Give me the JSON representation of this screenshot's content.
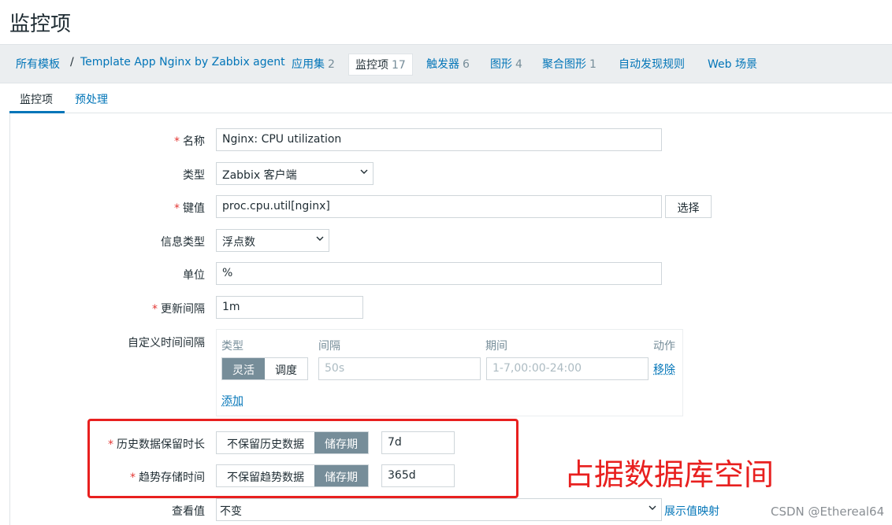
{
  "page": {
    "title": "监控项"
  },
  "breadcrumb": {
    "all_templates": "所有模板",
    "separator": "/",
    "template": "Template App Nginx by Zabbix agent",
    "items": [
      {
        "label": "应用集",
        "count": "2"
      },
      {
        "label": "监控项",
        "count": "17"
      },
      {
        "label": "触发器",
        "count": "6"
      },
      {
        "label": "图形",
        "count": "4"
      },
      {
        "label": "聚合图形",
        "count": "1"
      },
      {
        "label": "自动发现规则",
        "count": ""
      },
      {
        "label": "Web 场景",
        "count": ""
      }
    ]
  },
  "tabs": [
    {
      "label": "监控项"
    },
    {
      "label": "预处理"
    }
  ],
  "form": {
    "required_mark": "*",
    "name": {
      "label": "名称",
      "value": "Nginx: CPU utilization"
    },
    "type": {
      "label": "类型",
      "value": "Zabbix 客户端"
    },
    "key": {
      "label": "键值",
      "value": "proc.cpu.util[nginx]",
      "select_button": "选择"
    },
    "info_type": {
      "label": "信息类型",
      "value": "浮点数"
    },
    "units": {
      "label": "单位",
      "value": "%"
    },
    "update_interval": {
      "label": "更新间隔",
      "value": "1m"
    },
    "custom_intervals": {
      "label": "自定义时间间隔",
      "headers": {
        "type": "类型",
        "interval": "间隔",
        "period": "期间",
        "action": "动作"
      },
      "mode_flexible": "灵活",
      "mode_scheduling": "调度",
      "interval_placeholder": "50s",
      "period_placeholder": "1-7,00:00-24:00",
      "remove": "移除",
      "add": "添加"
    },
    "history": {
      "label": "历史数据保留时长",
      "no_keep": "不保留历史数据",
      "storage": "储存期",
      "value": "7d"
    },
    "trends": {
      "label": "趋势存储时间",
      "no_keep": "不保留趋势数据",
      "storage": "储存期",
      "value": "365d"
    },
    "show_value": {
      "label": "查看值",
      "value": "不变",
      "mapping_link": "展示值映射"
    }
  },
  "annotation": {
    "text": "占据数据库空间",
    "color": "#e8201f"
  },
  "watermark": "CSDN @Ethereal64",
  "colors": {
    "link": "#0275b8",
    "accent_segment": "#768d99",
    "required": "#e33734"
  }
}
